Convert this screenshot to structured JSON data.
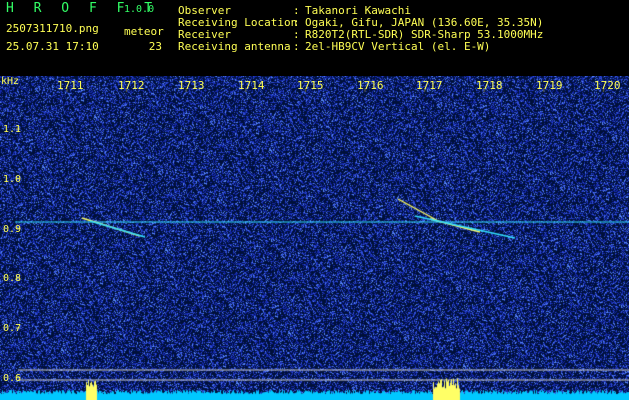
{
  "header": {
    "app_title": "H R O F F T",
    "app_version": "1.0.0",
    "filename": "2507311710.png",
    "datetime": "25.07.31 17:10",
    "meteor_label": "meteor",
    "meteor_count": "23"
  },
  "info": [
    {
      "label": "Observer",
      "value": "Takanori Kawachi"
    },
    {
      "label": "Receiving Location",
      "value": "Ogaki, Gifu, JAPAN (136.60E, 35.35N)"
    },
    {
      "label": "Receiver",
      "value": "R820T2(RTL-SDR) SDR-Sharp 53.1000MHz"
    },
    {
      "label": "Receiving antenna",
      "value": "2el-HB9CV Vertical (el. E-W)"
    }
  ],
  "spectrogram": {
    "y_unit": "kHz",
    "x_ticks": [
      "1711",
      "1712",
      "1713",
      "1714",
      "1715",
      "1716",
      "1717",
      "1718",
      "1719",
      "1720"
    ],
    "y_ticks": [
      "1.1",
      "1.0",
      "0.9",
      "0.8",
      "0.7",
      "0.6"
    ],
    "colors": {
      "background": "#00103a",
      "noise": "#2a3fd0",
      "signal": "#ffff66",
      "trace": "#33e0ff",
      "text": "#ffff55"
    }
  }
}
